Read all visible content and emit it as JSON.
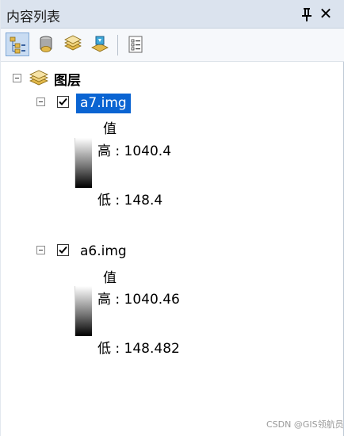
{
  "window": {
    "title": "内容列表"
  },
  "toolbar": {
    "buttons": [
      {
        "icon": "list-by-drawing-order-icon",
        "active": true
      },
      {
        "icon": "list-by-source-icon",
        "active": false
      },
      {
        "icon": "list-by-visibility-icon",
        "active": false
      },
      {
        "icon": "list-by-selection-icon",
        "active": false
      },
      {
        "icon": "options-icon",
        "active": false
      }
    ]
  },
  "tree": {
    "root": {
      "label": "图层",
      "expanded": true
    },
    "layers": [
      {
        "name": "a7.img",
        "checked": true,
        "selected": true,
        "legend": {
          "field": "值",
          "high": "高 : 1040.4",
          "low": "低 : 148.4"
        }
      },
      {
        "name": "a6.img",
        "checked": true,
        "selected": false,
        "legend": {
          "field": "值",
          "high": "高 : 1040.46",
          "low": "低 : 148.482"
        }
      }
    ]
  },
  "watermark": "CSDN @GIS领航员",
  "colors": {
    "titlebar": "#dbe3ee",
    "selection": "#0a64d2",
    "toolbar": "#f6f8fb"
  }
}
